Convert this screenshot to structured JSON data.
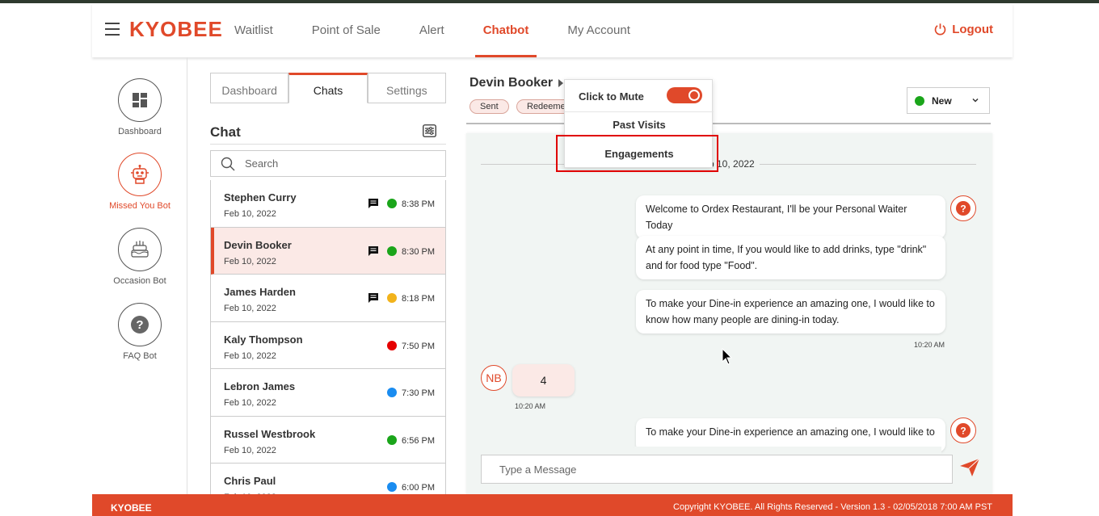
{
  "header": {
    "logo": "KYOBEE",
    "nav": [
      "Waitlist",
      "Point of Sale",
      "Alert",
      "Chatbot",
      "My Account"
    ],
    "active_nav": "Chatbot",
    "logout": "Logout"
  },
  "sidebar": {
    "items": [
      {
        "label": "Dashboard",
        "icon": "dashboard-icon"
      },
      {
        "label": "Missed You Bot",
        "icon": "robot-icon"
      },
      {
        "label": "Occasion Bot",
        "icon": "cake-icon"
      },
      {
        "label": "FAQ Bot",
        "icon": "question-icon"
      }
    ]
  },
  "chat_panel": {
    "tabs": [
      "Dashboard",
      "Chats",
      "Settings"
    ],
    "active_tab": "Chats",
    "title": "Chat",
    "search_placeholder": "Search",
    "rows": [
      {
        "name": "Stephen Curry",
        "date": "Feb 10, 2022",
        "time": "8:38 PM",
        "dot": "#1aa51a",
        "msg": true
      },
      {
        "name": "Devin Booker",
        "date": "Feb 10, 2022",
        "time": "8:30 PM",
        "dot": "#1aa51a",
        "msg": true
      },
      {
        "name": "James Harden",
        "date": "Feb 10, 2022",
        "time": "8:18 PM",
        "dot": "#f2b31b",
        "msg": true
      },
      {
        "name": "Kaly Thompson",
        "date": "Feb 10, 2022",
        "time": "7:50 PM",
        "dot": "#e50000",
        "msg": false
      },
      {
        "name": "Lebron James",
        "date": "Feb 10, 2022",
        "time": "7:30 PM",
        "dot": "#1a8cf0",
        "msg": false
      },
      {
        "name": "Russel Westbrook",
        "date": "Feb 10, 2022",
        "time": "6:56 PM",
        "dot": "#1aa51a",
        "msg": false
      },
      {
        "name": "Chris Paul",
        "date": "Feb 10, 2022",
        "time": "6:00 PM",
        "dot": "#1a8cf0",
        "msg": false
      }
    ]
  },
  "conversation": {
    "name": "Devin Booker",
    "tags": [
      "Sent",
      "Redeemed"
    ],
    "status": "New",
    "status_color": "#1aa51a",
    "date_separator": "Feb 10, 2022",
    "bot_messages": [
      "Welcome to Ordex Restaurant, I'll be your Personal Waiter Today",
      "At any point in time, If you would like to add drinks, type \"drink\" and for food type \"Food\".",
      "To make your Dine-in experience an amazing one, I would like to know how many people are dining-in today."
    ],
    "bot_time": "10:20 AM",
    "user_initials": "NB",
    "user_reply": "4",
    "user_time": "10:20 AM",
    "next_bot_message": "To make your Dine-in experience an amazing one, I would like to",
    "input_placeholder": "Type a Message"
  },
  "dropdown": {
    "mute_label": "Click to Mute",
    "mute_on": true,
    "past_visits": "Past Visits",
    "engagements": "Engagements"
  },
  "footer": {
    "left": "KYOBEE",
    "right": "Copyright KYOBEE. All Rights Reserved - Version 1.3 - 02/05/2018 7:00 AM PST"
  },
  "colors": {
    "brand": "#e0492a"
  }
}
